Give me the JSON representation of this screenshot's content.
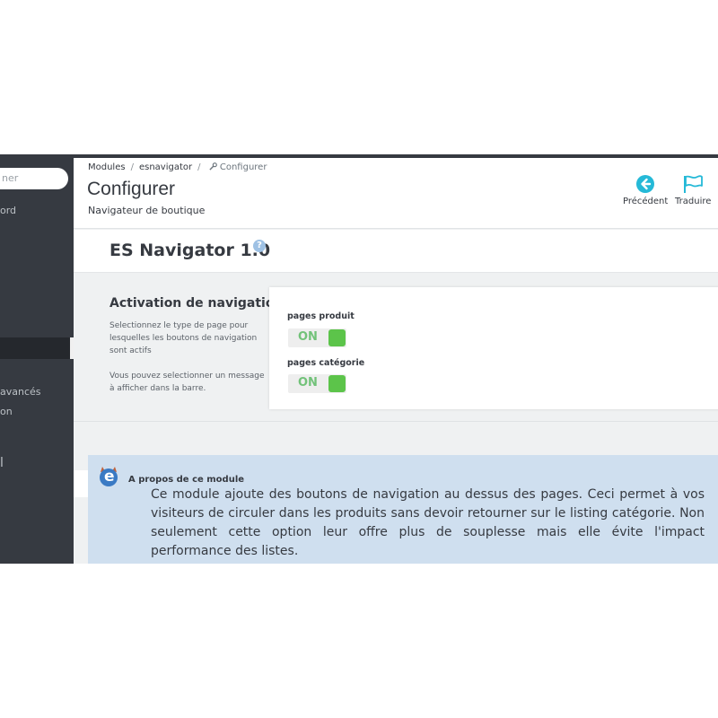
{
  "sidebar": {
    "search_placeholder": "ner",
    "items": [
      {
        "label": "ord"
      },
      {
        "label": "avancés"
      },
      {
        "label": "on"
      },
      {
        "label": "l"
      }
    ]
  },
  "breadcrumb": {
    "items": [
      "Modules",
      "esnavigator",
      "Configurer"
    ]
  },
  "header": {
    "title": "Configurer",
    "subtitle": "Navigateur de boutique",
    "back_label": "Précédent",
    "translate_label": "Traduire"
  },
  "module": {
    "title": "ES Navigator 1.0",
    "help_icon": "?"
  },
  "config": {
    "title": "Activation de navigation",
    "desc1": "Selectionnez le type de page pour lesquelles les boutons de navigation sont actifs",
    "desc2": "Vous pouvez selectionner un message à afficher dans la barre.",
    "fields": [
      {
        "label": "pages produit",
        "state": "ON"
      },
      {
        "label": "pages catégorie",
        "state": "ON"
      }
    ]
  },
  "info": {
    "logo_letter": "e",
    "title": "A propos de ce module",
    "text": "Ce module ajoute des boutons de navigation au dessus des pages. Ceci permet à vos visiteurs de circuler dans les produits sans devoir retourner sur le listing catégorie. Non seulement cette option leur offre plus de souplesse mais elle évite l'impact performance des listes."
  },
  "colors": {
    "sidebar": "#363a41",
    "accent": "#25b9d7",
    "toggle_on": "#5cc44a",
    "info_bg": "#cfdfef"
  },
  "icons": {
    "back": "arrow-left-circle-icon",
    "translate": "flag-icon",
    "wrench": "wrench-icon"
  }
}
